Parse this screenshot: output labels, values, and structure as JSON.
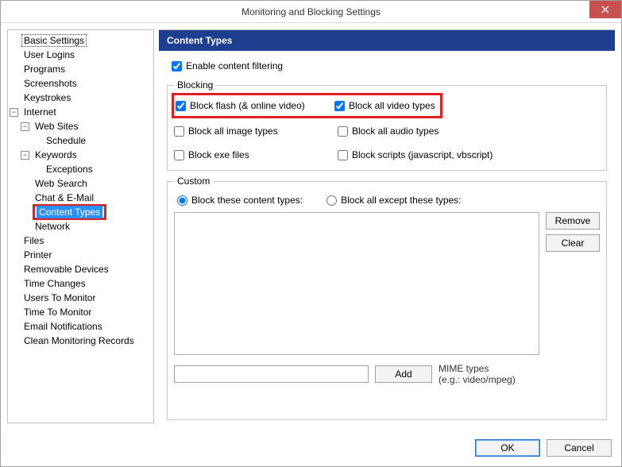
{
  "title": "Monitoring and Blocking Settings",
  "tree": {
    "basic": "Basic Settings",
    "userlogins": "User Logins",
    "programs": "Programs",
    "screenshots": "Screenshots",
    "keystrokes": "Keystrokes",
    "internet": "Internet",
    "websites": "Web Sites",
    "schedule": "Schedule",
    "keywords": "Keywords",
    "exceptions": "Exceptions",
    "websearch": "Web Search",
    "chatemail": "Chat & E-Mail",
    "contenttypes": "Content Types",
    "network": "Network",
    "files": "Files",
    "printer": "Printer",
    "removable": "Removable Devices",
    "timechanges": "Time Changes",
    "userstomonitor": "Users To Monitor",
    "timetomonitor": "Time To Monitor",
    "emailnotif": "Email Notifications",
    "cleanrecords": "Clean Monitoring Records"
  },
  "header": "Content Types",
  "enable_filter": "Enable content filtering",
  "blocking": {
    "legend": "Blocking",
    "flash": "Block flash (& online video)",
    "allvideo": "Block all video types",
    "allimage": "Block all image types",
    "allaudio": "Block all audio types",
    "exe": "Block exe files",
    "scripts": "Block scripts (javascript, vbscript)"
  },
  "custom": {
    "legend": "Custom",
    "radio_these": "Block these content types:",
    "radio_except": "Block all except these types:",
    "remove": "Remove",
    "clear": "Clear",
    "add": "Add",
    "mime1": "MIME types",
    "mime2": "(e.g.: video/mpeg)",
    "input_value": ""
  },
  "footer": {
    "ok": "OK",
    "cancel": "Cancel"
  }
}
